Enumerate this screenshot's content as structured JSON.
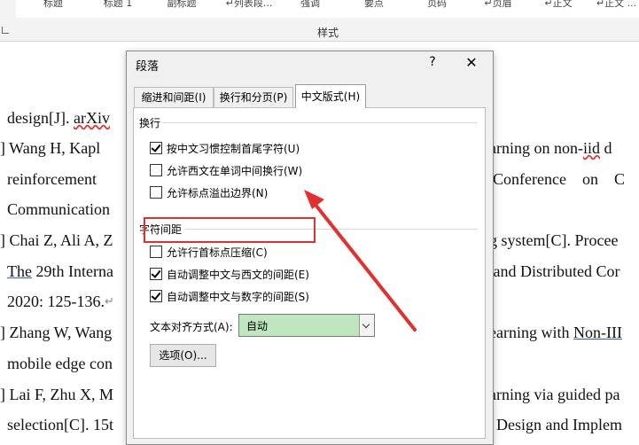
{
  "ribbon": {
    "styles": [
      "标题",
      "标题 1",
      "副标题",
      "↵列表段...",
      "强调",
      "要点",
      "页码",
      "↵页眉",
      "↵正文",
      "↵正文 ..."
    ],
    "group_label": "样式"
  },
  "document": {
    "lines": [
      {
        "segments": [
          {
            "t": "design[J]. "
          },
          {
            "t": "arXiv",
            "style": "sq-red"
          }
        ]
      },
      {
        "segments": [
          {
            "t": "] Wang H, Kapl"
          }
        ]
      },
      {
        "segments": [
          {
            "t": "arning on non-"
          },
          {
            "t": "iid",
            "style": "sq-red"
          },
          {
            "t": " d"
          }
        ]
      },
      {
        "segments": [
          {
            "t": "reinforcement"
          }
        ]
      },
      {
        "segments": [
          {
            "t": "Conference    on    C"
          }
        ]
      },
      {
        "segments": [
          {
            "t": "Communication"
          }
        ]
      },
      {
        "segments": [
          {
            "t": "] Chai Z, Ali A, Z"
          }
        ]
      },
      {
        "segments": [
          {
            "t": "g system[C]. Procee"
          }
        ]
      },
      {
        "segments": [
          {
            "t": "The",
            "style": "ul-blue"
          },
          {
            "t": " 29th Interna"
          }
        ]
      },
      {
        "segments": [
          {
            "t": " and Distributed Cor"
          }
        ]
      },
      {
        "segments": [
          {
            "t": "2020: 125-136."
          }
        ]
      },
      {
        "segments": [
          {
            "t": "] Zhang W, Wang"
          }
        ]
      },
      {
        "segments": [
          {
            "t": "earning with "
          },
          {
            "t": "Non-III",
            "style": "ul-blue"
          }
        ]
      },
      {
        "segments": [
          {
            "t": "mobile edge con"
          }
        ]
      },
      {
        "segments": [
          {
            "t": "] Lai F, Zhu X, M"
          }
        ]
      },
      {
        "segments": [
          {
            "t": "arning via guided pa"
          }
        ]
      },
      {
        "segments": [
          {
            "t": "selection[C]. 15t"
          }
        ]
      },
      {
        "segments": [
          {
            "t": "Design and Implem"
          }
        ]
      }
    ],
    "para_mark": "↵"
  },
  "dialog": {
    "title": "段落",
    "help": "?",
    "close": "✕",
    "tabs": [
      "缩进和间距(I)",
      "换行和分页(P)",
      "中文版式(H)"
    ],
    "active_tab": 2,
    "line_break_section": "换行",
    "line_break_options": [
      {
        "label": "按中文习惯控制首尾字符(U)",
        "checked": true
      },
      {
        "label": "允许西文在单词中间换行(W)",
        "checked": false
      },
      {
        "label": "允许标点溢出边界(N)",
        "checked": false
      }
    ],
    "spacing_section": "字符间距",
    "spacing_options": [
      {
        "label": "允许行首标点压缩(C)",
        "checked": false
      },
      {
        "label": "自动调整中文与西文的间距(E)",
        "checked": true
      },
      {
        "label": "自动调整中文与数字的间距(S)",
        "checked": true
      }
    ],
    "align_label": "文本对齐方式(A):",
    "align_value": "自动",
    "options_button": "选项(O)..."
  },
  "colors": {
    "highlight": "#e23030",
    "select_bg": "#bfe6bf",
    "dialog_bg": "#f0f0f0"
  }
}
